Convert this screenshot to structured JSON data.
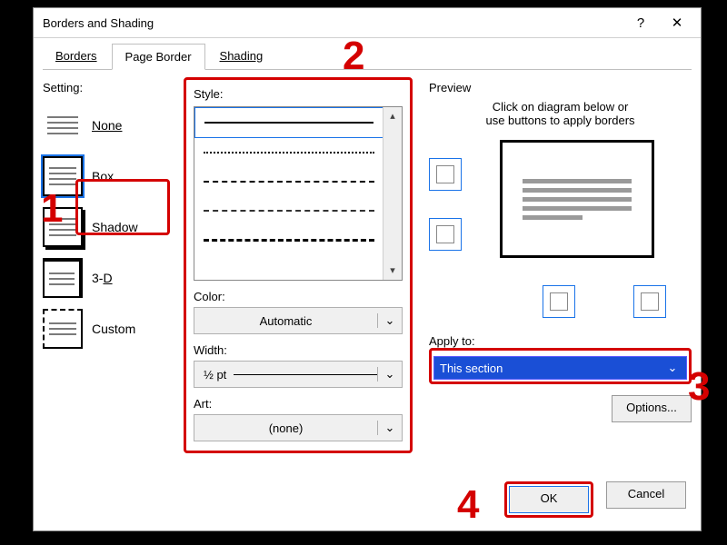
{
  "title": "Borders and Shading",
  "tabs": {
    "borders": "Borders",
    "page_border": "Page Border",
    "shading": "Shading"
  },
  "setting": {
    "label": "Setting:",
    "none": "None",
    "box": "Box",
    "shadow": "Shadow",
    "threeD": "3-D",
    "custom": "Custom"
  },
  "style": {
    "label": "Style:",
    "color_label": "Color:",
    "color_value": "Automatic",
    "width_label": "Width:",
    "width_value": "½ pt",
    "art_label": "Art:",
    "art_value": "(none)"
  },
  "preview": {
    "label": "Preview",
    "msg1": "Click on diagram below or",
    "msg2": "use buttons to apply borders",
    "apply_label": "Apply to:",
    "apply_value": "This section",
    "options": "Options..."
  },
  "buttons": {
    "ok": "OK",
    "cancel": "Cancel"
  },
  "annotations": {
    "n1": "1",
    "n2": "2",
    "n3": "3",
    "n4": "4"
  }
}
